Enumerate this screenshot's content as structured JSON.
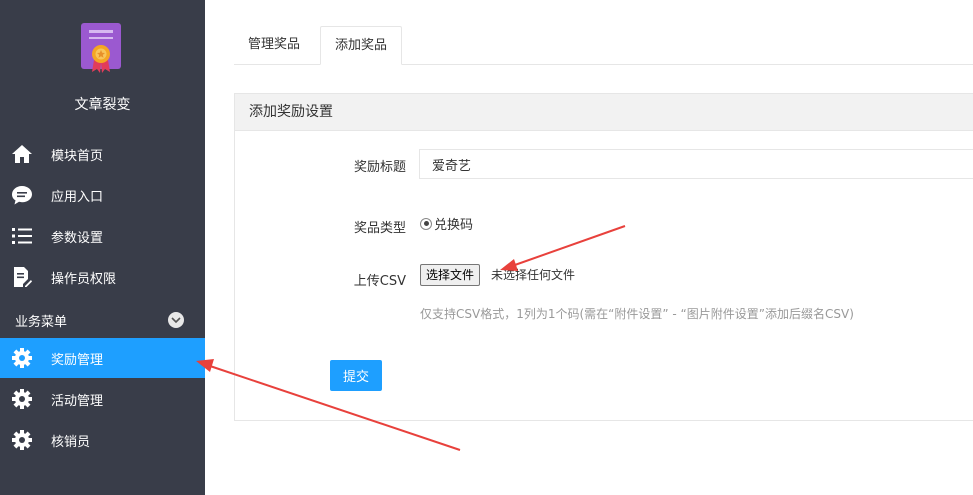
{
  "sidebar": {
    "app_title": "文章裂变",
    "items": [
      {
        "label": "模块首页",
        "icon": "home-icon"
      },
      {
        "label": "应用入口",
        "icon": "chat-icon"
      },
      {
        "label": "参数设置",
        "icon": "list-icon"
      },
      {
        "label": "操作员权限",
        "icon": "edit-doc-icon"
      }
    ],
    "section_title": "业务菜单",
    "section_items": [
      {
        "label": "奖励管理",
        "icon": "gear-icon",
        "active": true
      },
      {
        "label": "活动管理",
        "icon": "gear-icon"
      },
      {
        "label": "核销员",
        "icon": "gear-icon"
      }
    ]
  },
  "tabs": [
    {
      "label": "管理奖品"
    },
    {
      "label": "添加奖品",
      "active": true
    }
  ],
  "panel": {
    "title": "添加奖励设置",
    "reward_title_label": "奖励标题",
    "reward_title_value": "爱奇艺",
    "prize_type_label": "奖品类型",
    "prize_type_option": "兑换码",
    "upload_label": "上传CSV",
    "file_button": "选择文件",
    "file_status": "未选择任何文件",
    "hint": "仅支持CSV格式，1列为1个码(需在“附件设置” - “图片附件设置”添加后缀名CSV)",
    "submit_label": "提交"
  },
  "colors": {
    "sidebar_bg": "#393d49",
    "accent": "#1e9fff",
    "annotation_arrow": "#e8413c"
  }
}
